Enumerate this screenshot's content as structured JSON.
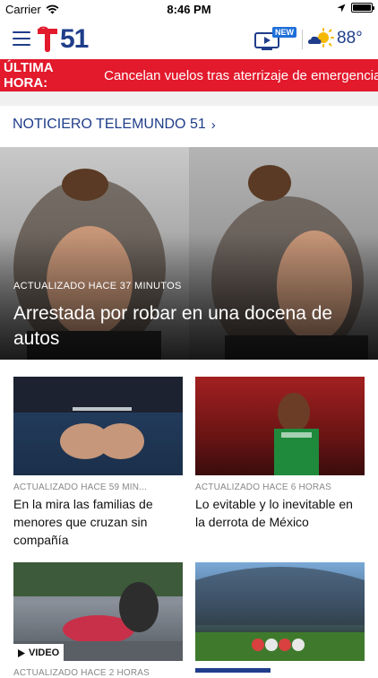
{
  "status_bar": {
    "carrier": "Carrier",
    "time": "8:46 PM"
  },
  "header": {
    "logo_number": "51",
    "video_badge": "NEW",
    "temperature": "88°",
    "weather_icon": "partly-sunny-icon"
  },
  "breaking": {
    "tag": "ÚLTIMA HORA:",
    "headline": "Cancelan vuelos tras aterrizaje de emergencia"
  },
  "section": {
    "label": "NOTICIERO TELEMUNDO 51",
    "chevron": "›"
  },
  "hero": {
    "meta": "ACTUALIZADO HACE 37 MINUTOS",
    "title": "Arrestada por robar en una docena de autos"
  },
  "cards": [
    {
      "meta": "ACTUALIZADO HACE 59 MIN...",
      "title": "En la mira las familias de menores que cruzan sin compañía"
    },
    {
      "meta": "ACTUALIZADO HACE 6 HORAS",
      "title": "Lo evitable y lo inevitable en la derrota de México"
    },
    {
      "meta": "ACTUALIZADO HACE 2 HORAS",
      "title": "",
      "video_label": "VIDEO"
    },
    {
      "meta": "",
      "title": ""
    }
  ],
  "colors": {
    "brand_blue": "#1f3d8a",
    "breaking_red": "#e3192c",
    "badge_blue": "#1e6fd9"
  }
}
